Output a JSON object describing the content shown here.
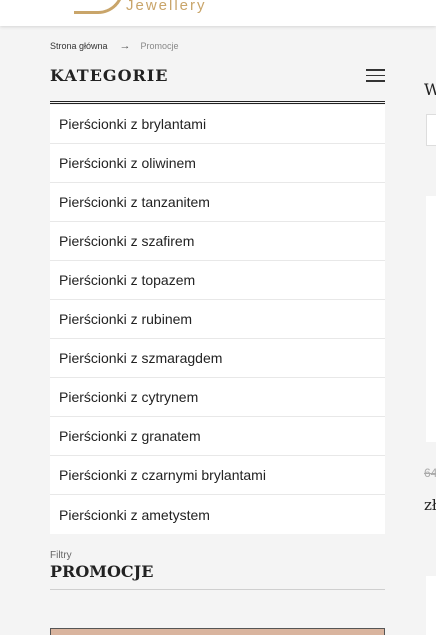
{
  "header": {
    "logo_text": "Jewellery"
  },
  "breadcrumb": {
    "home": "Strona główna",
    "separator": "→",
    "current": "Promocje"
  },
  "categories": {
    "title": "KATEGORIE",
    "items": [
      "Pierścionki z brylantami",
      "Pierścionki z oliwinem",
      "Pierścionki z tanzanitem",
      "Pierścionki z szafirem",
      "Pierścionki z topazem",
      "Pierścionki z rubinem",
      "Pierścionki z szmaragdem",
      "Pierścionki z cytrynem",
      "Pierścionki z granatem",
      "Pierścionki z czarnymi brylantami",
      "Pierścionki z ametystem"
    ]
  },
  "filters": {
    "label": "Filtry",
    "title": "PROMOCJE"
  },
  "right_column": {
    "heading_fragment": "W",
    "old_price_fragment": "64",
    "price_fragment": "zł"
  },
  "colors": {
    "accent_gold": "#c9a56a",
    "banner": "#d9b49e"
  }
}
